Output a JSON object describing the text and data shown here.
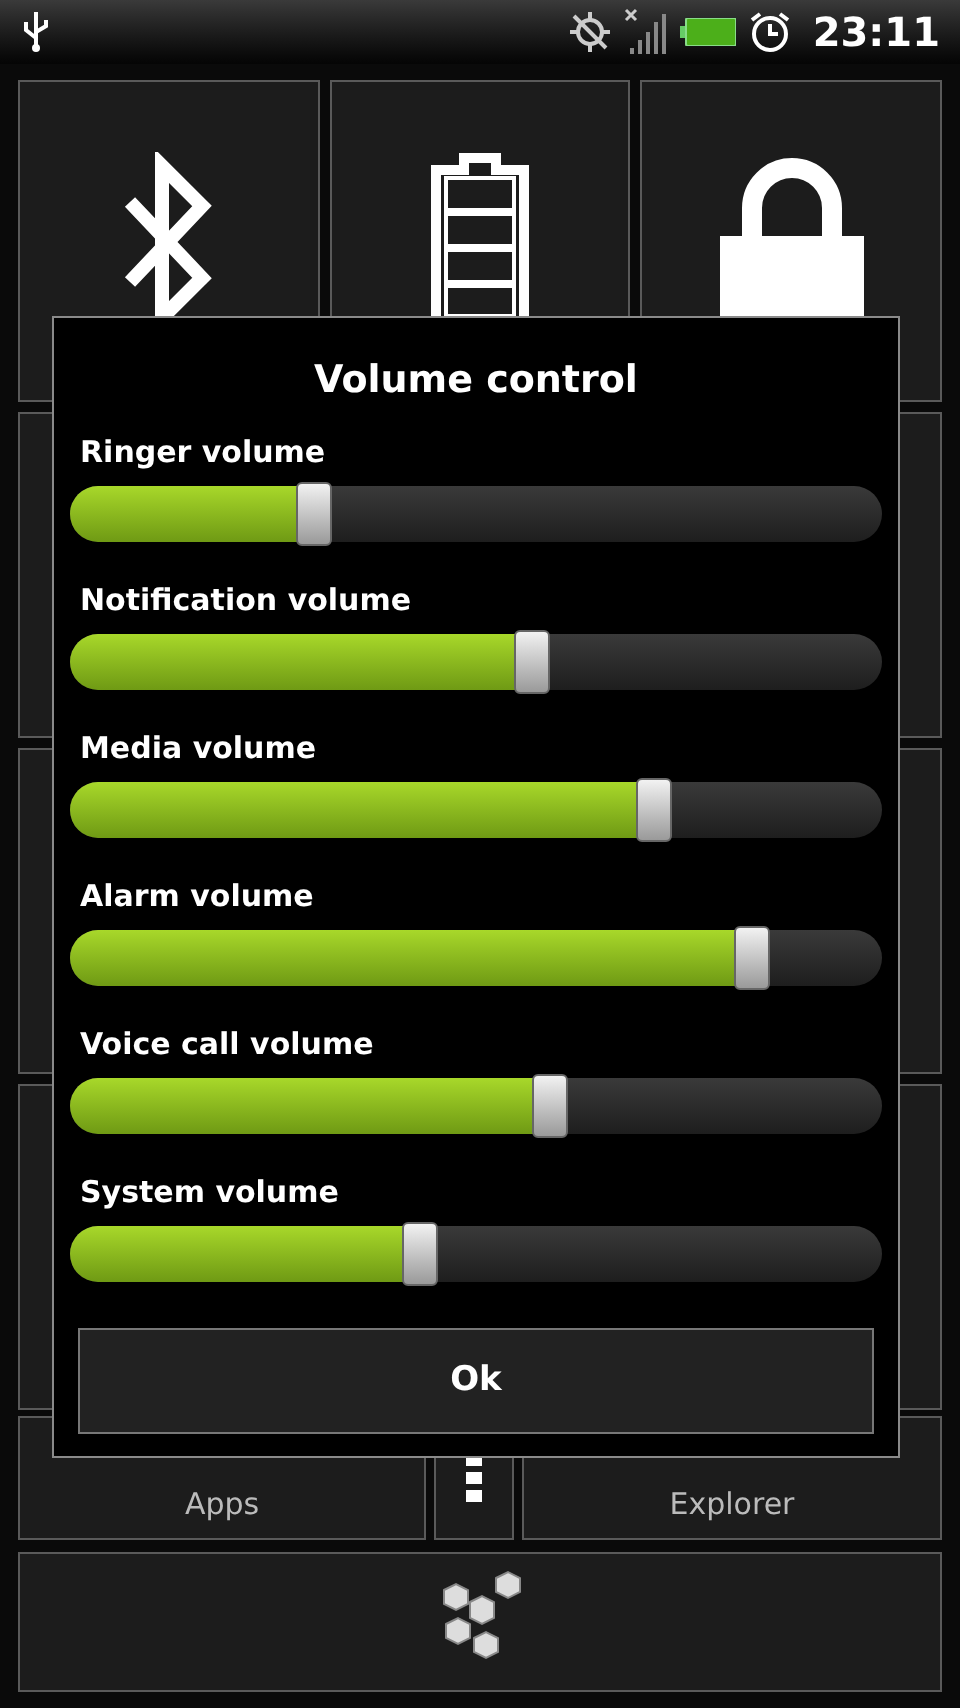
{
  "status_bar": {
    "time": "23:11"
  },
  "home_tiles": [
    {
      "label": "Apps"
    },
    {
      "label": "Explorer"
    }
  ],
  "dialog": {
    "title": "Volume control",
    "sliders": [
      {
        "label": "Ringer volume",
        "level": 0.3
      },
      {
        "label": "Notification volume",
        "level": 0.57
      },
      {
        "label": "Media volume",
        "level": 0.72
      },
      {
        "label": "Alarm volume",
        "level": 0.84
      },
      {
        "label": "Voice call volume",
        "level": 0.59
      },
      {
        "label": "System volume",
        "level": 0.43
      }
    ],
    "buttons": [
      "Ok"
    ]
  }
}
